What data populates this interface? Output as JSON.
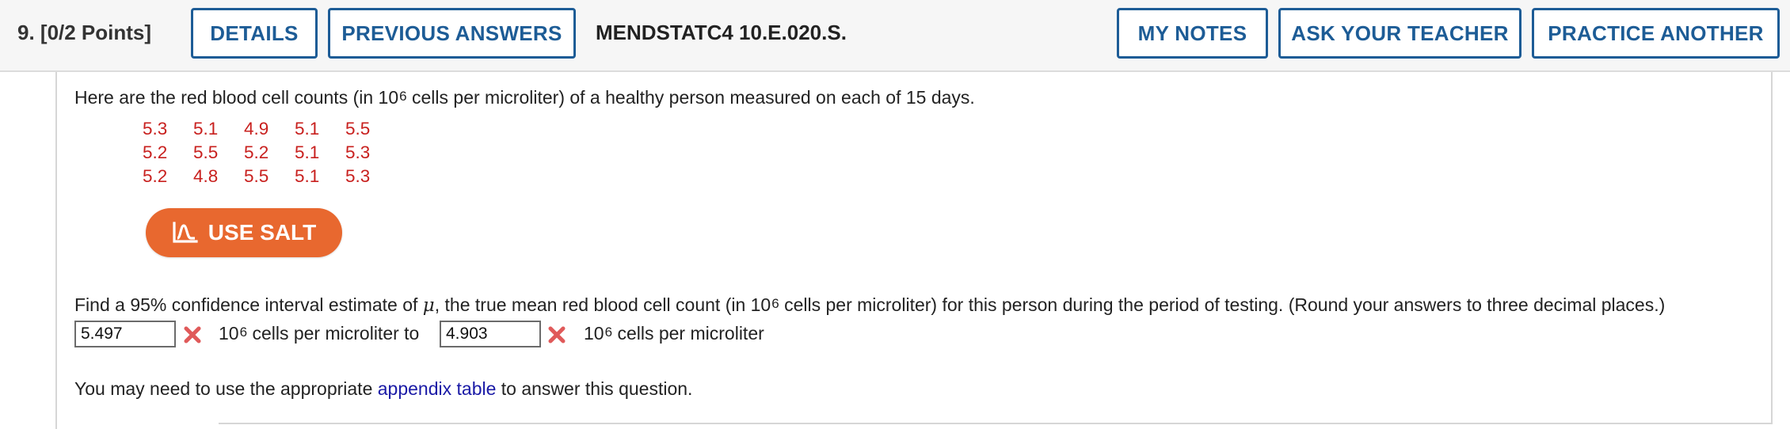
{
  "header": {
    "question_label": "9.  [0/2 Points]",
    "details": "DETAILS",
    "previous_answers": "PREVIOUS ANSWERS",
    "code": "MENDSTATC4 10.E.020.S.",
    "my_notes": "MY NOTES",
    "ask_teacher": "ASK YOUR TEACHER",
    "practice_another": "PRACTICE ANOTHER"
  },
  "intro": {
    "before": "Here are the red blood cell counts (in 10",
    "exp": "6",
    "after": " cells per microliter) of a healthy person measured on each of 15 days."
  },
  "data_values": [
    "5.3",
    "5.1",
    "4.9",
    "5.1",
    "5.5",
    "5.2",
    "5.5",
    "5.2",
    "5.1",
    "5.3",
    "5.2",
    "4.8",
    "5.5",
    "5.1",
    "5.3"
  ],
  "salt_button": "USE SALT",
  "question": {
    "before": "Find a 95% confidence interval estimate of ",
    "mu": "μ",
    "middle": ", the true mean red blood cell count (in 10",
    "exp": "6",
    "after": " cells per microliter) for this person during the period of testing. (Round your answers to three decimal places.)"
  },
  "answers": {
    "lower_value": "5.497",
    "upper_value": "4.903",
    "unit_base": "10",
    "unit_exp": "6",
    "unit_text_to": " cells per microliter to",
    "unit_text": " cells per microliter"
  },
  "footer": {
    "before": "You may need to use the appropriate ",
    "link": "appendix table",
    "after": " to answer this question."
  },
  "colors": {
    "brand_blue": "#1d5c96",
    "salt_orange": "#e8682f",
    "data_red": "#c8201e",
    "incorrect_red": "#e05a5a",
    "link_blue": "#1a1aa6"
  }
}
